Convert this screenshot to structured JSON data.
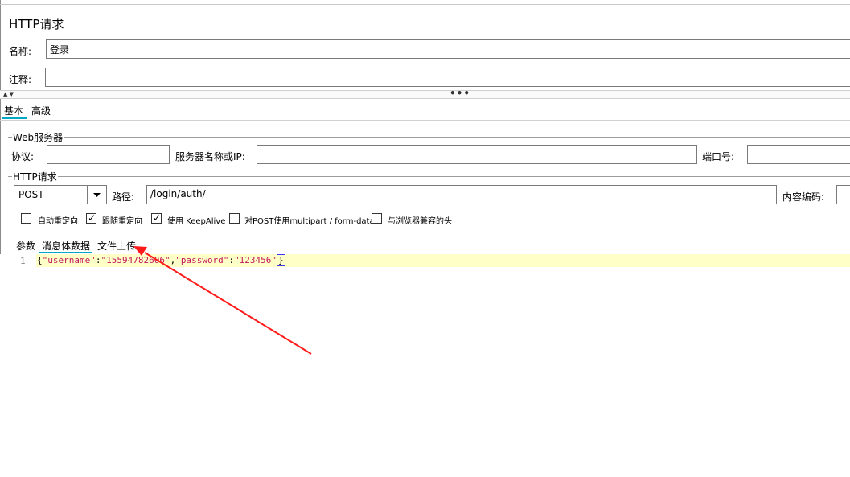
{
  "panel": {
    "title": "HTTP请求"
  },
  "name_field": {
    "label": "名称:",
    "value": "登录"
  },
  "comment_field": {
    "label": "注释:",
    "value": ""
  },
  "main_tabs": [
    {
      "label": "基本"
    },
    {
      "label": "高级"
    }
  ],
  "web_server": {
    "group_title": "Web服务器",
    "protocol_label": "协议:",
    "protocol_value": "",
    "server_label": "服务器名称或IP:",
    "server_value": "",
    "port_label": "端口号:",
    "port_value": ""
  },
  "http_request": {
    "group_title": "HTTP请求",
    "method": "POST",
    "path_label": "路径:",
    "path_value": "/login/auth/",
    "encoding_label": "内容编码:",
    "encoding_value": ""
  },
  "options": [
    {
      "label": "自动重定向",
      "checked": false
    },
    {
      "label": "跟随重定向",
      "checked": true
    },
    {
      "label": "使用 KeepAlive",
      "checked": true
    },
    {
      "label": "对POST使用multipart / form-data",
      "checked": false
    },
    {
      "label": "与浏览器兼容的头",
      "checked": false
    }
  ],
  "body_tabs": [
    {
      "label": "参数"
    },
    {
      "label": "消息体数据"
    },
    {
      "label": "文件上传"
    }
  ],
  "editor": {
    "line_number": "1",
    "code_open": "{",
    "code_key1": "\"username\"",
    "code_colon1": ":",
    "code_val1": "\"15594782606\"",
    "code_comma": ",",
    "code_key2": "\"password\"",
    "code_colon2": ":",
    "code_val2": "\"123456\"",
    "code_close": "}"
  },
  "annotation": {
    "color": "#ff1a1a"
  }
}
